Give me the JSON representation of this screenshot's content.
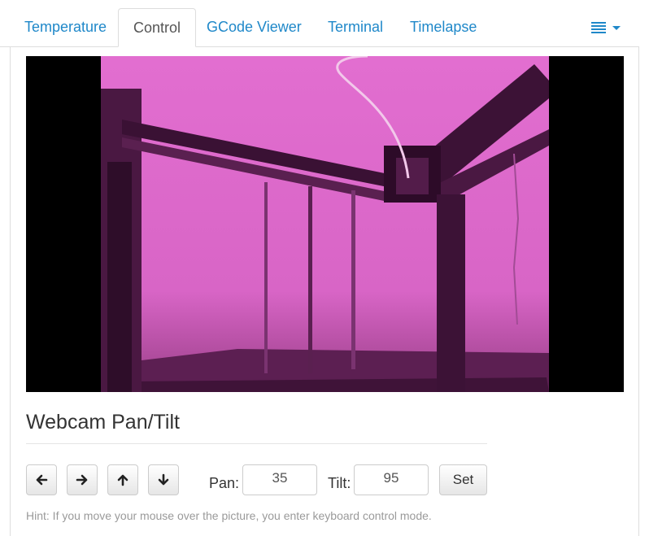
{
  "tabs": [
    {
      "label": "Temperature"
    },
    {
      "label": "Control"
    },
    {
      "label": "GCode Viewer"
    },
    {
      "label": "Terminal"
    },
    {
      "label": "Timelapse"
    }
  ],
  "active_tab": "Control",
  "menu": {
    "icon": "list-icon"
  },
  "colors": {
    "link": "#1f88c9",
    "tint": "#d85ec3"
  },
  "webcam": {
    "icon": "webcam-stream-image"
  },
  "pantilt": {
    "title": "Webcam Pan/Tilt",
    "arrows": [
      "arrow-left-icon",
      "arrow-right-icon",
      "arrow-up-icon",
      "arrow-down-icon"
    ],
    "pan_label": "Pan:",
    "pan_value": "35",
    "tilt_label": "Tilt:",
    "tilt_value": "95",
    "set_label": "Set",
    "hint": "Hint: If you move your mouse over the picture, you enter keyboard control mode."
  }
}
